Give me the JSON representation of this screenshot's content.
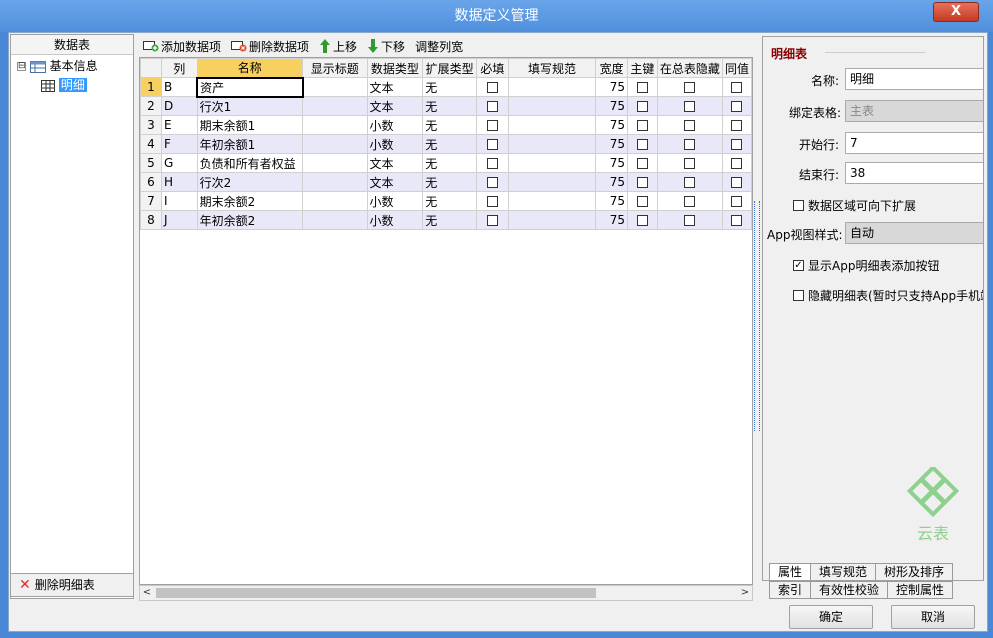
{
  "window": {
    "title": "数据定义管理",
    "close_label": "X"
  },
  "left_panel": {
    "header": "数据表",
    "tree": [
      {
        "label": "基本信息",
        "expander": "⊟",
        "icon": "table-icon"
      },
      {
        "label": "明细",
        "icon": "grid-icon",
        "selected": true
      }
    ],
    "delete_button": "删除明细表"
  },
  "toolbar": {
    "add_label": "添加数据项",
    "delete_label": "删除数据项",
    "up_label": "上移",
    "down_label": "下移",
    "fit_label": "调整列宽"
  },
  "grid": {
    "columns": [
      "列",
      "名称",
      "显示标题",
      "数据类型",
      "扩展类型",
      "必填",
      "填写规范",
      "宽度",
      "主键",
      "在总表隐藏",
      "同值"
    ],
    "rows": [
      {
        "num": "1",
        "col": "B",
        "name": "资产",
        "title": "",
        "type": "文本",
        "ext": "无",
        "width": "75"
      },
      {
        "num": "2",
        "col": "D",
        "name": "行次1",
        "title": "",
        "type": "文本",
        "ext": "无",
        "width": "75"
      },
      {
        "num": "3",
        "col": "E",
        "name": "期末余额1",
        "title": "",
        "type": "小数",
        "ext": "无",
        "width": "75"
      },
      {
        "num": "4",
        "col": "F",
        "name": "年初余额1",
        "title": "",
        "type": "小数",
        "ext": "无",
        "width": "75"
      },
      {
        "num": "5",
        "col": "G",
        "name": "负债和所有者权益",
        "title": "",
        "type": "文本",
        "ext": "无",
        "width": "75"
      },
      {
        "num": "6",
        "col": "H",
        "name": "行次2",
        "title": "",
        "type": "文本",
        "ext": "无",
        "width": "75"
      },
      {
        "num": "7",
        "col": "I",
        "name": "期末余额2",
        "title": "",
        "type": "小数",
        "ext": "无",
        "width": "75"
      },
      {
        "num": "8",
        "col": "J",
        "name": "年初余额2",
        "title": "",
        "type": "小数",
        "ext": "无",
        "width": "75"
      }
    ]
  },
  "properties": {
    "title": "明细表",
    "name_label": "名称:",
    "name_value": "明细",
    "bind_label": "绑定表格:",
    "bind_value": "主表",
    "start_label": "开始行:",
    "start_value": "7",
    "end_label": "结束行:",
    "end_value": "38",
    "expand_label": "数据区域可向下扩展",
    "expand_checked": false,
    "app_view_label": "App视图样式:",
    "app_view_value": "自动",
    "show_add_label": "显示App明细表添加按钮",
    "show_add_checked": true,
    "hide_label": "隐藏明细表(暂时只支持App手机端",
    "hide_checked": false,
    "logo_text": "云表",
    "tabs_row1": [
      "属性",
      "填写规范",
      "树形及排序"
    ],
    "tabs_row2": [
      "索引",
      "有效性校验",
      "控制属性"
    ]
  },
  "buttons": {
    "ok": "确定",
    "cancel": "取消"
  },
  "colors": {
    "title_bar": "#4f8fdc",
    "selected": "#3399ff",
    "active_header": "#f8d060",
    "title_red": "#8b0000"
  }
}
